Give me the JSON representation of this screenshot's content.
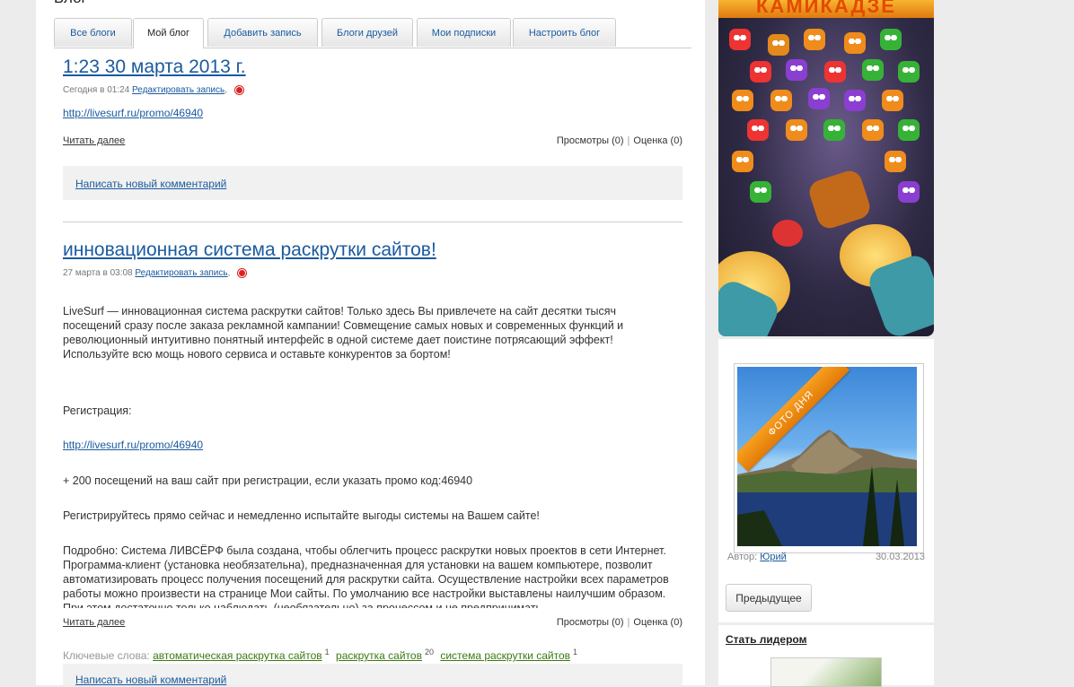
{
  "page": {
    "title": "Блог"
  },
  "tabs": [
    {
      "label": "Все блоги"
    },
    {
      "label": "Мой блог"
    },
    {
      "label": "Добавить запись"
    },
    {
      "label": "Блоги друзей"
    },
    {
      "label": "Мои подписки"
    },
    {
      "label": "Настроить блог"
    }
  ],
  "posts": [
    {
      "title": "1:23 30 марта 2013 г.",
      "date": "Сегодня в 01:24",
      "edit_label": "Редактировать запись",
      "link": "http://livesurf.ru/promo/46940",
      "read_more": "Читать далее",
      "views": "Просмотры (0)",
      "rating": "Оценка (0)",
      "comment_label": "Написать новый комментарий"
    },
    {
      "title": "инновационная система раскрутки сайтов!",
      "date": "27 марта в 03:08",
      "edit_label": "Редактировать запись",
      "paragraph1": "LiveSurf — инновационная система раскрутки сайтов! Только здесь Вы привлечете на сайт десятки тысяч посещений сразу после заказа рекламной кампании! Совмещение самых новых и современных функций и революционный интуитивно понятный интерфейс в одной системе дает поистине потрясающий эффект! Используйте всю мощь нового сервиса и оставьте конкурентов за бортом!",
      "registration": "Регистрация:",
      "link": "http://livesurf.ru/promo/46940",
      "bonus": "+ 200 посещений на ваш сайт при регистрации, если указать промо код:46940",
      "cta": "Регистрируйтесь прямо сейчас и немедленно испытайте выгоды системы на Вашем сайте!",
      "details": "Подробно: Система ЛИВСЁРФ была создана, чтобы облегчить процесс раскрутки новых проектов в сети Интернет. Программа-клиент (установка необязательна), предназначенная для установки на вашем компьютере, позволит автоматизировать процесс получения посещений для раскрутки сайта. Осуществление настройки всех параметров работы можно произвести на странице Мои сайты. По умолчанию все настройки выставлены наилучшим образом. При этом достаточно только наблюдать (необязательно) за процессом и не предпринимать",
      "read_more": "Читать далее",
      "views": "Просмотры (0)",
      "rating": "Оценка (0)",
      "keywords_label": "Ключевые слова:",
      "keywords": [
        {
          "text": "автоматическая раскрутка сайтов",
          "count": "1"
        },
        {
          "text": "раскрутка сайтов",
          "count": "20"
        },
        {
          "text": "система раскрутки сайтов",
          "count": "1"
        }
      ],
      "comment_label": "Написать новый комментарий"
    }
  ],
  "sidebar": {
    "banner_title": "КАМИКАДЗЕ",
    "photo_of_day": {
      "ribbon": "ФОТО ДНЯ",
      "author_label": "Автор:",
      "author_name": "Юрий",
      "date": "30.03.2013",
      "prev_label": "Предыдущее"
    },
    "leader_label": "Стать лидером"
  },
  "colors": {
    "link": "#1a5a9e",
    "keyword": "#3a7a12",
    "ribbon": "#f28c0f"
  }
}
